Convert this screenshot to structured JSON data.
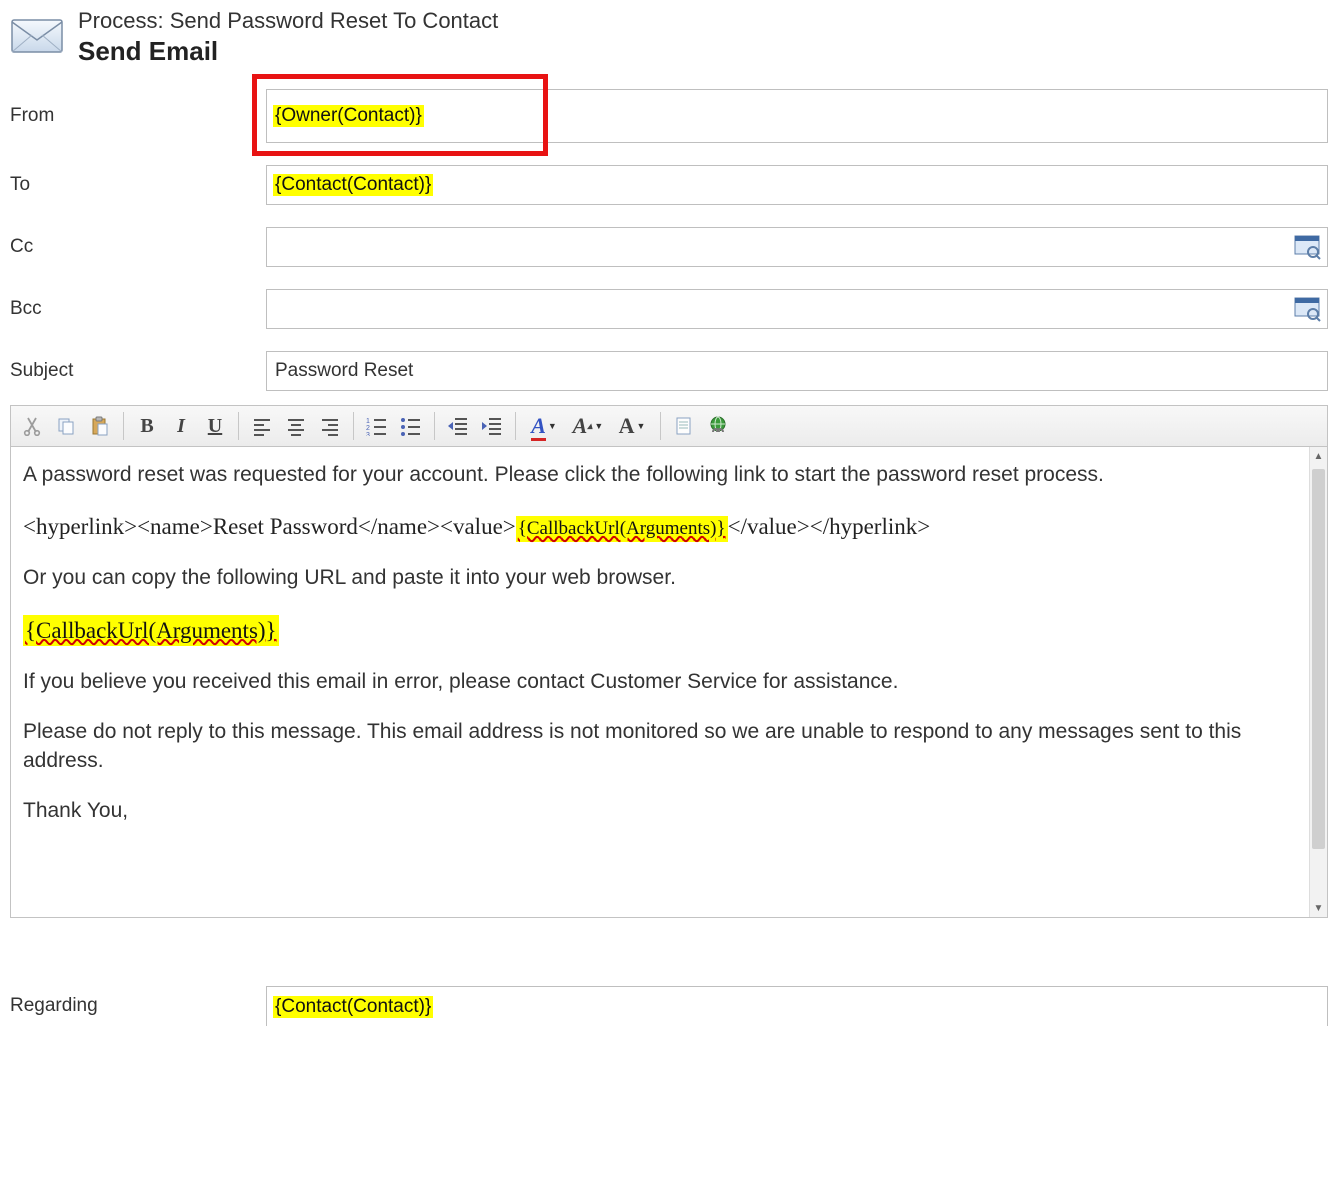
{
  "header": {
    "process_line": "Process: Send Password Reset To Contact",
    "title": "Send Email"
  },
  "fields": {
    "from": {
      "label": "From",
      "value": "{Owner(Contact)}"
    },
    "to": {
      "label": "To",
      "value": "{Contact(Contact)}"
    },
    "cc": {
      "label": "Cc",
      "value": ""
    },
    "bcc": {
      "label": "Bcc",
      "value": ""
    },
    "subject": {
      "label": "Subject",
      "value": "Password Reset"
    },
    "regarding": {
      "label": "Regarding",
      "value": "{Contact(Contact)}"
    }
  },
  "toolbar": {
    "cut": "Cut",
    "copy": "Copy",
    "paste": "Paste",
    "bold": "B",
    "italic": "I",
    "underline": "U",
    "align_left": "Align Left",
    "align_center": "Align Center",
    "align_right": "Align Right",
    "list_num": "Numbered List",
    "list_bul": "Bulleted List",
    "outdent": "Decrease Indent",
    "indent": "Increase Indent",
    "font_color_glyph": "A",
    "font_size_glyph": "A",
    "font_face_glyph": "A",
    "insert_item": "Insert",
    "insert_link": "Insert Hyperlink"
  },
  "body": {
    "p1": "A password reset was requested for your account. Please click the following link to start the password reset process.",
    "hlink_pre": "<hyperlink><name>Reset Password</name><value>",
    "hlink_token": "{CallbackUrl(Arguments)}",
    "hlink_post": "</value></hyperlink>",
    "p2": "Or you can copy the following URL and paste it into your web browser.",
    "url_token": "{CallbackUrl(Arguments)}",
    "p3": "If you believe you received this email in error, please contact Customer Service for assistance.",
    "p4": "Please do not reply to this message. This email address is not monitored so we are unable to respond to any messages sent to this address.",
    "p5": "Thank You,"
  }
}
